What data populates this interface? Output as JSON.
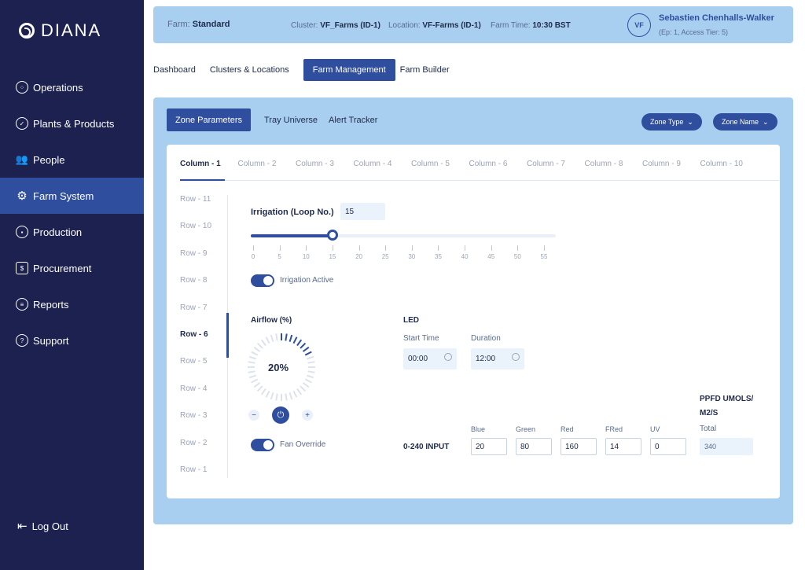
{
  "brand": {
    "name": "DIANA"
  },
  "sidebar": {
    "items": [
      {
        "label": "Operations",
        "icon": "operations-icon"
      },
      {
        "label": "Plants & Products",
        "icon": "plant-icon"
      },
      {
        "label": "People",
        "icon": "people-icon"
      },
      {
        "label": "Farm System",
        "icon": "gear-icon",
        "active": true
      },
      {
        "label": "Production",
        "icon": "production-icon"
      },
      {
        "label": "Procurement",
        "icon": "procurement-icon"
      },
      {
        "label": "Reports",
        "icon": "reports-icon"
      },
      {
        "label": "Support",
        "icon": "support-icon"
      }
    ],
    "logout": "Log Out"
  },
  "topbar": {
    "farm_label": "Farm:",
    "farm_value": "Standard",
    "cluster_label": "Cluster:",
    "cluster_value": "VF_Farms (ID-1)",
    "location_label": "Location:",
    "location_value": "VF-Farms (ID-1)",
    "time_label": "Farm Time:",
    "time_value": "10:30 BST",
    "user_initials": "VF",
    "user_name": "Sebastien Chenhalls-Walker",
    "user_sub": "(Ep: 1, Access Tier: 5)"
  },
  "tabs": [
    {
      "label": "Dashboard"
    },
    {
      "label": "Clusters & Locations"
    },
    {
      "label": "Farm Management",
      "active": true
    },
    {
      "label": "Farm Builder"
    }
  ],
  "subtabs": [
    {
      "label": "Zone Parameters",
      "active": true
    },
    {
      "label": "Tray Universe"
    },
    {
      "label": "Alert Tracker"
    }
  ],
  "filters": {
    "zone_type": "Zone Type",
    "zone_name": "Zone Name"
  },
  "columns": [
    "Column - 1",
    "Column - 2",
    "Column - 3",
    "Column - 4",
    "Column - 5",
    "Column - 6",
    "Column - 7",
    "Column - 8",
    "Column - 9",
    "Column - 10"
  ],
  "active_column": 0,
  "rows": [
    "Row - 11",
    "Row - 10",
    "Row - 9",
    "Row - 8",
    "Row - 7",
    "Row - 6",
    "Row - 5",
    "Row - 4",
    "Row - 3",
    "Row - 2",
    "Row - 1"
  ],
  "active_row": 5,
  "irrigation": {
    "label": "Irrigation (Loop No.)",
    "value": "15",
    "slider_min": 0,
    "slider_max": 55,
    "slider_value": 15,
    "ticks": [
      "0",
      "5",
      "10",
      "15",
      "20",
      "25",
      "30",
      "35",
      "40",
      "45",
      "50",
      "55"
    ],
    "active_label": "Irrigation Active"
  },
  "airflow": {
    "label": "Airflow (%)",
    "value": "20%",
    "percent": 20,
    "minus": "−",
    "plus": "+",
    "fan_override_label": "Fan Override"
  },
  "led": {
    "label": "LED",
    "start_label": "Start Time",
    "start_value": "00:00",
    "duration_label": "Duration",
    "duration_value": "12:00"
  },
  "ppfd": {
    "title_line1": "PPFD UMOLS/",
    "title_line2": "M2/S",
    "input_label": "0-240 INPUT",
    "channels": [
      {
        "label": "Blue",
        "value": "20"
      },
      {
        "label": "Green",
        "value": "80"
      },
      {
        "label": "Red",
        "value": "160"
      },
      {
        "label": "FRed",
        "value": "14"
      },
      {
        "label": "UV",
        "value": "0"
      }
    ],
    "total_label": "Total",
    "total_value": "340"
  },
  "colors": {
    "sidebar": "#1c2150",
    "accent": "#2f4f9e",
    "panel": "#a8cff0"
  }
}
